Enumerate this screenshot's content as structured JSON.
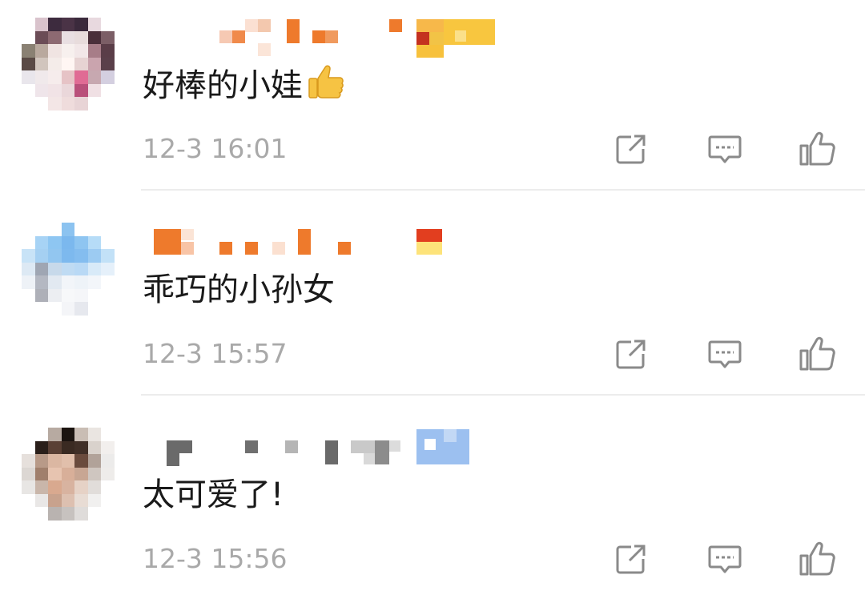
{
  "comments": [
    {
      "comment_text": "好棒的小娃",
      "has_emoji": true,
      "emoji": "thumbs-up-emoji",
      "timestamp": "12-3 16:01",
      "username_blurred": true,
      "avatar_blurred": true
    },
    {
      "comment_text": "乖巧的小孙女",
      "has_emoji": false,
      "timestamp": "12-3 15:57",
      "username_blurred": true,
      "avatar_blurred": true
    },
    {
      "comment_text": "太可爱了!",
      "has_emoji": false,
      "timestamp": "12-3 15:56",
      "username_blurred": true,
      "avatar_blurred": true
    }
  ],
  "actions": {
    "share_icon": "share-icon",
    "reply_icon": "reply-icon",
    "like_icon": "like-icon"
  },
  "colors": {
    "comment_text": "#1a1a1a",
    "timestamp": "#a9a9a9",
    "icon": "#8a8a8a",
    "divider": "#ececec",
    "emoji": "#f6c343"
  }
}
